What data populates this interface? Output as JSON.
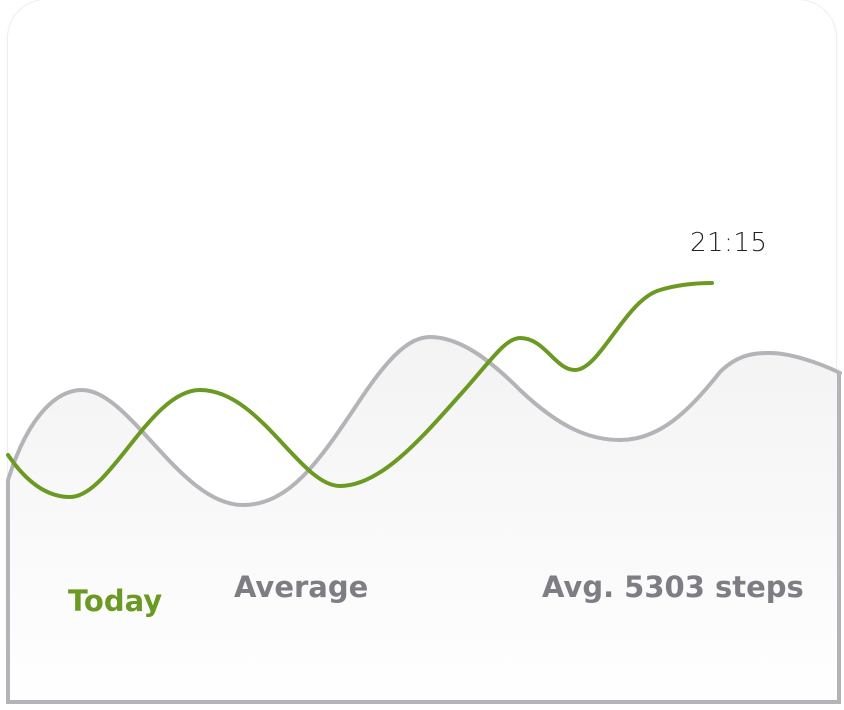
{
  "time_marker": "21:15",
  "legend": {
    "today_label": "Today",
    "average_label": "Average",
    "avg_steps_label": "Avg. 5303 steps"
  },
  "colors": {
    "today": "#6b9a23",
    "average": "#b3b3b8",
    "label_gray": "#7d7d83"
  },
  "chart_data": {
    "type": "line",
    "series": [
      {
        "name": "Today"
      },
      {
        "name": "Average"
      }
    ]
  }
}
